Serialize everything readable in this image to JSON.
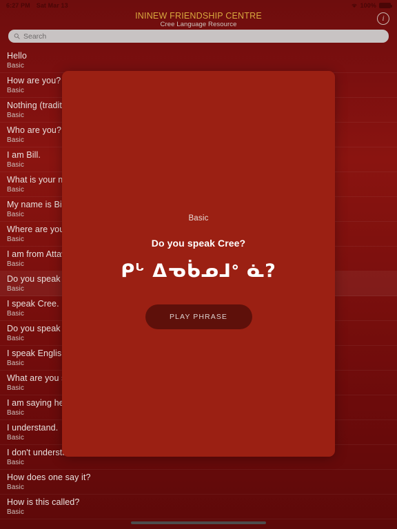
{
  "status_bar": {
    "time": "6:27 PM",
    "date": "Sat Mar 13",
    "battery_percent": "100%",
    "wifi_icon": "wifi-icon",
    "battery_icon": "battery-icon"
  },
  "header": {
    "title": "ININEW FRIENDSHIP CENTRE",
    "subtitle": "Cree Language Resource",
    "info_icon": "info-icon",
    "info_glyph": "i"
  },
  "search": {
    "placeholder": "Search",
    "value": "",
    "icon": "search-icon"
  },
  "list": {
    "rows": [
      {
        "title": "Hello",
        "category": "Basic",
        "selected": false
      },
      {
        "title": "How are you?",
        "category": "Basic",
        "selected": false
      },
      {
        "title": "Nothing (traditional response)",
        "category": "Basic",
        "selected": false
      },
      {
        "title": "Who are you?",
        "category": "Basic",
        "selected": false
      },
      {
        "title": "I am Bill.",
        "category": "Basic",
        "selected": false
      },
      {
        "title": "What is your name?",
        "category": "Basic",
        "selected": false
      },
      {
        "title": "My name is Bill.",
        "category": "Basic",
        "selected": false
      },
      {
        "title": "Where are you from?",
        "category": "Basic",
        "selected": false
      },
      {
        "title": "I am from Attawapiskat.",
        "category": "Basic",
        "selected": false
      },
      {
        "title": "Do you speak Cree?",
        "category": "Basic",
        "selected": true
      },
      {
        "title": "I speak Cree.",
        "category": "Basic",
        "selected": false
      },
      {
        "title": "Do you speak English?",
        "category": "Basic",
        "selected": false
      },
      {
        "title": "I speak English.",
        "category": "Basic",
        "selected": false
      },
      {
        "title": "What are you saying?",
        "category": "Basic",
        "selected": false
      },
      {
        "title": "I am saying hello.",
        "category": "Basic",
        "selected": false
      },
      {
        "title": "I understand.",
        "category": "Basic",
        "selected": false
      },
      {
        "title": "I don't understand.",
        "category": "Basic",
        "selected": false
      },
      {
        "title": "How does one say it?",
        "category": "Basic",
        "selected": false
      },
      {
        "title": "How is this called?",
        "category": "Basic",
        "selected": false
      }
    ]
  },
  "modal": {
    "category": "Basic",
    "english": "Do you speak Cree?",
    "syllabics": "ᑭᒡ ᐃᓀᑳᓄᒧᐤ ᓈ?",
    "play_button_label": "PLAY PHRASE"
  },
  "colors": {
    "background_red": "#7b0f0f",
    "modal_red": "#9b2013",
    "title_gold": "#d8a93f",
    "button_dark_red": "#5e100a",
    "search_gray": "#c8c3c3"
  },
  "home_indicator": "home-indicator"
}
